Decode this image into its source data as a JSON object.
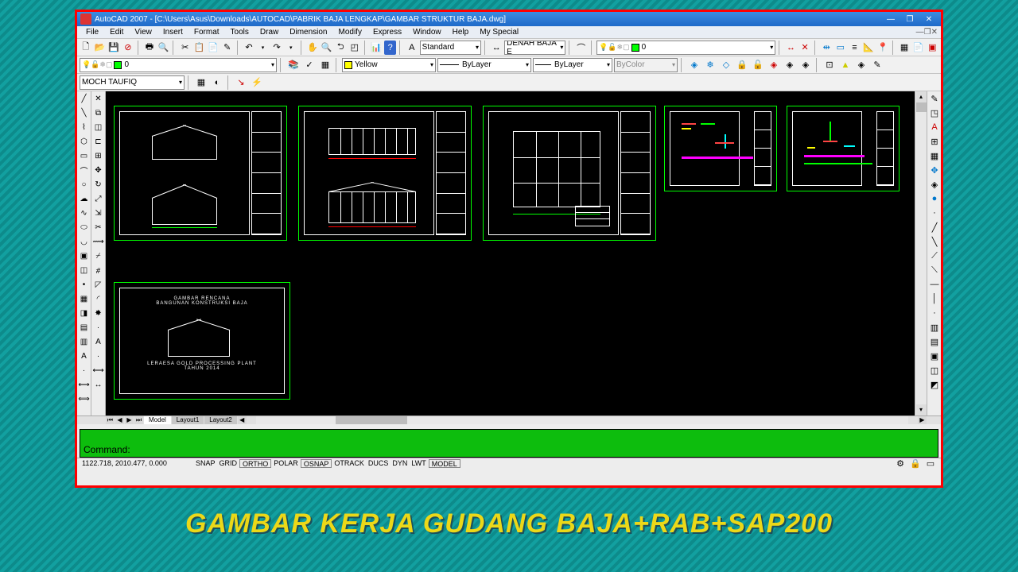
{
  "title": "AutoCAD 2007 - [C:\\Users\\Asus\\Downloads\\AUTOCAD\\PABRIK BAJA LENGKAP\\GAMBAR STRUKTUR BAJA.dwg]",
  "menus": [
    "File",
    "Edit",
    "View",
    "Insert",
    "Format",
    "Tools",
    "Draw",
    "Dimension",
    "Modify",
    "Express",
    "Window",
    "Help",
    "My Special"
  ],
  "layer": {
    "color": "#00ff00",
    "name": "0",
    "states": "♀●■●"
  },
  "textStyle": "Standard",
  "dimStyle": "DENAH BAJA E",
  "colorName": "Yellow",
  "lineType": "ByLayer",
  "lineWeight": "ByLayer",
  "plotStyle": "ByColor",
  "userCombo": "MOCH TAUFIQ",
  "tabs": [
    "Model",
    "Layout1",
    "Layout2"
  ],
  "activeTab": "Model",
  "command": "Command:",
  "coords": "1122.718, 2010.477, 0.000",
  "statusToggles": [
    "SNAP",
    "GRID",
    "ORTHO",
    "POLAR",
    "OSNAP",
    "OTRACK",
    "DUCS",
    "DYN",
    "LWT",
    "MODEL"
  ],
  "cover": {
    "t1": "GAMBAR RENCANA",
    "t2": "BANGUNAN KONSTRUKSI BAJA",
    "t3": "LERAESA GOLD PROCESSING PLANT",
    "t4": "TAHUN 2014"
  },
  "caption": "GAMBAR KERJA GUDANG BAJA+RAB+SAP200"
}
